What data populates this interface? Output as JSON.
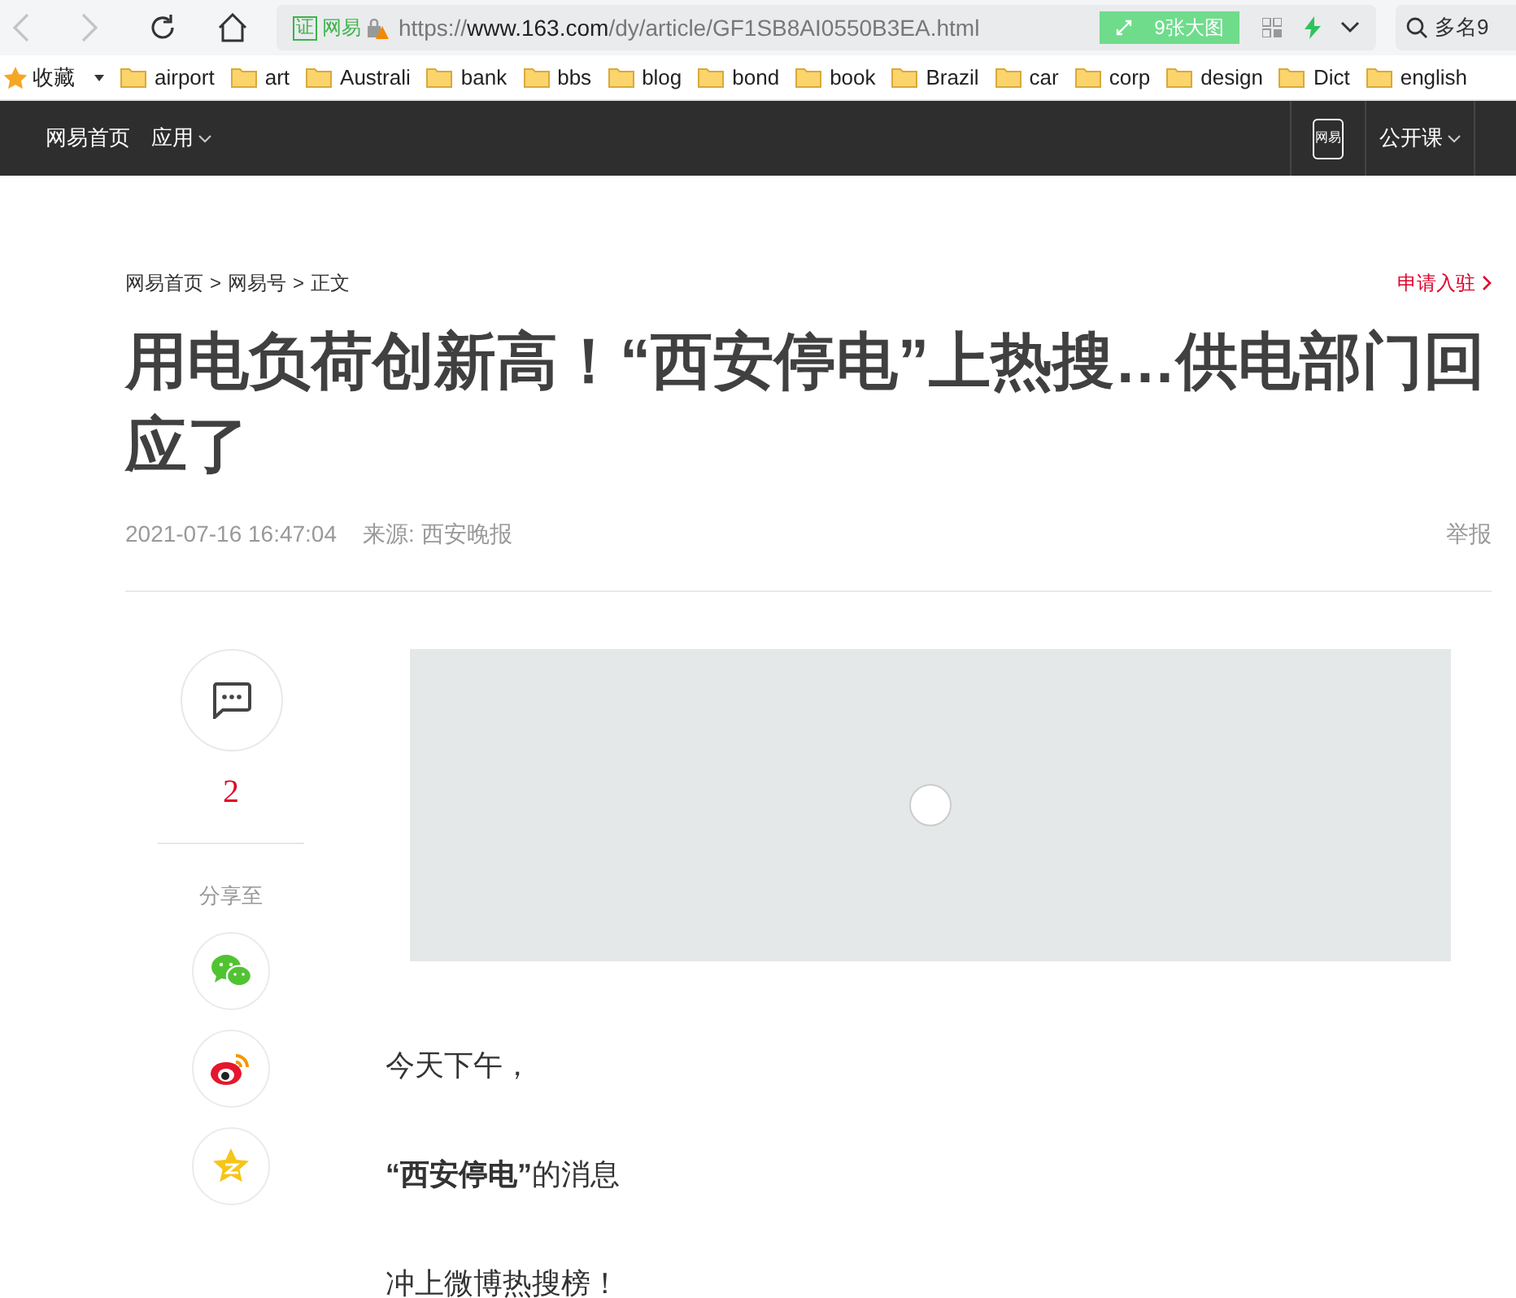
{
  "address_bar": {
    "cert_badge": "证",
    "site_label": "网易",
    "url_scheme": "https://",
    "url_host": "www.163.com",
    "url_path": "/dy/article/GF1SB8AI0550B3EA.html",
    "gallery_button": "9张大图",
    "search_text": "多名9"
  },
  "bookmarks": {
    "favorites_label": "收藏",
    "folders": [
      "airport",
      "art",
      "Australi",
      "bank",
      "bbs",
      "blog",
      "bond",
      "book",
      "Brazil",
      "car",
      "corp",
      "design",
      "Dict",
      "english"
    ]
  },
  "site_nav": {
    "left": [
      {
        "label": "网易首页",
        "dropdown": false
      },
      {
        "label": "应用",
        "dropdown": true
      }
    ],
    "app_label": "网易",
    "right": [
      {
        "label": "公开课",
        "dropdown": true
      }
    ]
  },
  "article": {
    "breadcrumb": [
      "网易首页",
      "网易号",
      "正文"
    ],
    "separator": ">",
    "join_link": "申请入驻",
    "title": "用电负荷创新高！“西安停电”上热搜…供电部门回应了",
    "date": "2021-07-16 16:47:04",
    "source": "来源: 西安晚报",
    "report": "举报",
    "sidebar": {
      "comment_count": "2",
      "share_label": "分享至",
      "share_buttons": [
        {
          "kind": "wechat"
        },
        {
          "kind": "weibo"
        },
        {
          "kind": "qzone"
        }
      ]
    },
    "paragraphs": [
      "今天下午，",
      "**“西安停电”**的消息",
      "冲上微博热搜榜！"
    ]
  }
}
